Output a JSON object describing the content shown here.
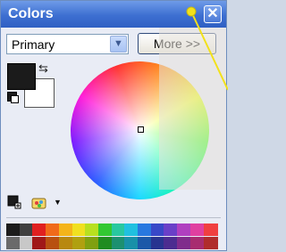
{
  "window": {
    "title": "Colors",
    "close_glyph": "✕"
  },
  "dropdown": {
    "value": "Primary",
    "arrow_icon": "chevron-down-icon"
  },
  "more_button": {
    "label": "More >>"
  },
  "colors": {
    "primary": "#1b1b1b",
    "secondary": "#ffffff"
  },
  "palette": {
    "row1": [
      "#1c1c1c",
      "#404040",
      "#e02020",
      "#f06a1a",
      "#f4b41a",
      "#f0e020",
      "#b8e020",
      "#32c832",
      "#28c8a0",
      "#20c0e0",
      "#2878e0",
      "#3848c8",
      "#6a40c8",
      "#b040c0",
      "#e040a0",
      "#f04040"
    ],
    "row2": [
      "#6a6a6a",
      "#c8c8c8",
      "#a01818",
      "#b85010",
      "#b88810",
      "#b0a010",
      "#80a010",
      "#208c20",
      "#1c9070",
      "#1890a8",
      "#1c58a8",
      "#283490",
      "#4c2c90",
      "#802c8c",
      "#a82c70",
      "#b02c2c"
    ]
  }
}
